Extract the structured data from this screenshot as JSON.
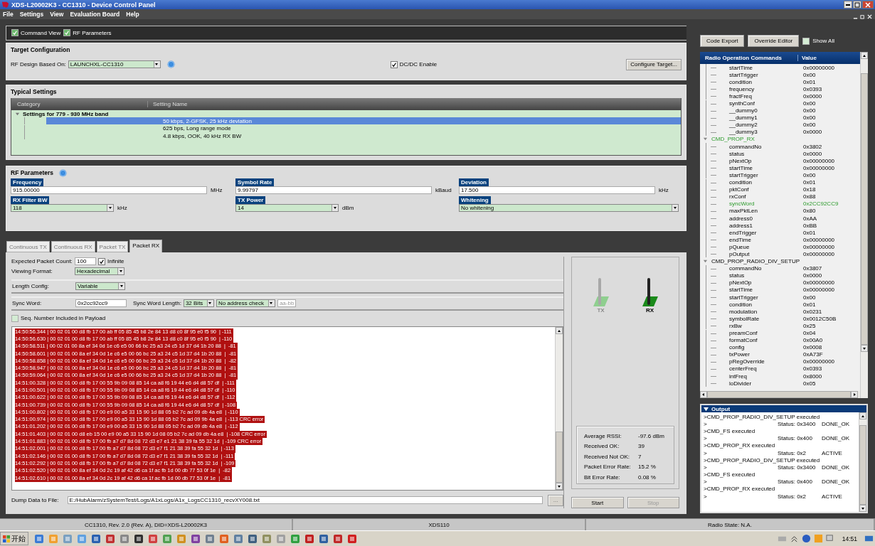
{
  "window": {
    "title": "XDS-L20002K3 - CC1310 - Device Control Panel"
  },
  "menu": [
    "File",
    "Settings",
    "View",
    "Evaluation Board",
    "Help"
  ],
  "view_toggles": [
    {
      "label": "Command View",
      "checked": true
    },
    {
      "label": "RF Parameters",
      "checked": true
    }
  ],
  "target_configuration": {
    "title": "Target Configuration",
    "design_label": "RF Design Based On:",
    "design_value": "LAUNCHXL-CC1310",
    "dcdc": {
      "label": "DC/DC Enable",
      "checked": true
    },
    "configure_button": "Configure Target..."
  },
  "typical_settings": {
    "title": "Typical Settings",
    "columns": [
      "Category",
      "Setting Name"
    ],
    "group": {
      "name": "Settings for 779 - 930 MHz band",
      "expanded": true
    },
    "items": [
      {
        "name": "50 kbps, 2-GFSK, 25 kHz deviation",
        "selected": true
      },
      {
        "name": "625 bps, Long range mode",
        "selected": false
      },
      {
        "name": "4.8 kbps, OOK, 40 kHz RX BW",
        "selected": false
      }
    ]
  },
  "rf_parameters": {
    "title": "RF Parameters",
    "fields": [
      {
        "label": "Frequency",
        "kind": "input",
        "value": "915.00000",
        "unit": "MHz"
      },
      {
        "label": "Symbol Rate",
        "kind": "input",
        "value": "9.99797",
        "unit": "kBaud"
      },
      {
        "label": "Deviation",
        "kind": "input",
        "value": "17.500",
        "unit": "kHz"
      },
      {
        "label": "RX Filter BW",
        "kind": "select",
        "value": "118",
        "unit": "kHz"
      },
      {
        "label": "TX Power",
        "kind": "select",
        "value": "14",
        "unit": "dBm"
      },
      {
        "label": "Whitening",
        "kind": "select",
        "value": "No whitening"
      }
    ]
  },
  "tabs": [
    {
      "label": "Continuous TX",
      "selected": false
    },
    {
      "label": "Continuous RX",
      "selected": false
    },
    {
      "label": "Packet TX",
      "selected": false
    },
    {
      "label": "Packet RX",
      "selected": true
    }
  ],
  "packet_rx": {
    "expected_label": "Expected Packet Count:",
    "expected_value": "100",
    "infinite": {
      "label": "Infinite",
      "checked": true
    },
    "viewing_label": "Viewing Format:",
    "viewing_value": "Hexadecimal",
    "length_label": "Length Config:",
    "length_value": "Variable",
    "sync_label": "Sync Word:",
    "sync_value": "0x2cc92cc9",
    "sync_length_label": "Sync Word Length:",
    "sync_length_value": "32 Bits",
    "address_check": "No address check",
    "address_value": "aa-bb",
    "seq": {
      "label": "Seq. Number Included in Payload",
      "checked": false
    },
    "log": [
      {
        "text": "14:50:56.344 | 00 02 01 00 d8 fb 17 00 ab ff 05 85 45 b8 2e 84 13 d8 c0 8f 95 e0 f5 90  | -111",
        "selected": true
      },
      {
        "text": "14:50:56.630 | 00 02 01 00 d8 fb 17 00 ab ff 05 85 45 b8 2e 84 13 d8 c0 8f 95 e0 f5 90  | -110",
        "selected": true
      },
      {
        "text": "14:50:58.511 | 00 02 01 00 8a ef 34 0d 1e c6 e5 00 66 bc 25 a3 24 c5 1d 37 d4 1b 20 88  |  -81",
        "selected": true
      },
      {
        "text": "14:50:58.601 | 00 02 01 00 8a ef 34 0d 1e c6 e5 00 66 bc 25 a3 24 c5 1d 37 d4 1b 20 88  |  -81",
        "selected": true
      },
      {
        "text": "14:50:58.858 | 00 02 01 00 8a ef 34 0d 1e c6 e5 00 66 bc 25 a3 24 c5 1d 37 d4 1b 20 88  |  -82",
        "selected": true
      },
      {
        "text": "14:50:58.947 | 00 02 01 00 8a ef 34 0d 1e c6 e5 00 66 bc 25 a3 24 c5 1d 37 d4 1b 20 88  |  -81",
        "selected": true
      },
      {
        "text": "14:50:59.064 | 00 02 01 00 8a ef 34 0d 1e c6 e5 00 66 bc 25 a3 24 c5 1d 37 d4 1b 20 88  |  -81",
        "selected": true
      },
      {
        "text": "14:51:00.328 | 00 02 01 00 d8 fb 17 00 55 9b 09 08 85 14 ca a8 f6 19 44 e6 d4 d8 57 df  | -111",
        "selected": true
      },
      {
        "text": "14:51:00.501 | 00 02 01 00 d8 fb 17 00 55 9b 09 08 85 14 ca a8 f6 19 44 e6 d4 d8 57 df  | -110",
        "selected": true
      },
      {
        "text": "14:51:00.622 | 00 02 01 00 d8 fb 17 00 55 9b 09 08 85 14 ca a8 f6 19 44 e6 d4 d8 57 df  | -112",
        "selected": true
      },
      {
        "text": "14:51:00.739 | 00 02 01 00 d8 fb 17 00 55 9b 09 08 85 14 ca a8 f6 19 44 e6 d4 d8 57 df  | -108",
        "selected": true
      },
      {
        "text": "14:51:00.802 | 00 02 01 00 d8 fb 17 00 e9 00 a5 33 15 90 1d 88 05 b2 7c ad 09 db 4a e8  | -110",
        "selected": true
      },
      {
        "text": "14:51:00.974 | 00 02 01 00 d8 fb 17 00 e9 00 a5 33 15 90 1d 88 05 b2 7c ad 09 9b 4a e8  | -113 CRC error",
        "selected": true
      },
      {
        "text": "14:51:01.202 | 00 02 01 00 d8 fb 17 00 e9 00 a5 33 15 90 1d 88 05 b2 7c ad 09 db 4a e8  | -112",
        "selected": true
      },
      {
        "text": "14:51:01.403 | 00 02 01 00 d8 eb 15 00 e9 00 a5 33 15 90 1d 08 05 b2 7c ad 09 db 4a e8  | -108 CRC error",
        "selected": true
      },
      {
        "text": "14:51:01.883 | 00 02 01 00 d8 fb 17 00 fb a7 d7 8d 08 72 d3 e7 e1 21 38 39 fa 55 32 1d  | -109 CRC error",
        "selected": true
      },
      {
        "text": "14:51:02.001 | 00 02 01 00 d8 fb 17 00 fb a7 d7 8d 08 72 d3 e7 f1 21 38 39 fa 55 32 1d  | -113",
        "selected": true
      },
      {
        "text": "14:51:02.146 | 00 02 01 00 d8 fb 17 00 fb a7 d7 8d 08 72 d3 e7 f1 21 38 39 fa 55 32 1d  | -111",
        "selected": true
      },
      {
        "text": "14:51:02.292 | 00 02 01 00 d8 fb 17 00 fb a7 d7 8d 08 72 d3 e7 f1 21 38 39 fa 55 32 1d  | -109",
        "selected": true
      },
      {
        "text": "14:51:02.520 | 00 02 01 00 8a ef 34 0d 2c 19 af 42 d6 ca 1f ac fb 1d 00 db 77 53 0f 1e  |  -82",
        "selected": true
      },
      {
        "text": "14:51:02.610 | 00 02 01 00 8a ef 34 0d 2c 19 af 42 d6 ca 1f ac fb 1d 00 db 77 53 0f 1e  |  -81",
        "selected": true
      }
    ],
    "dump_label": "Dump Data to File:",
    "dump_path": "E:/HubAlarm/zSystemTest/Logs/A1xLogs/A1x_LogsCC1310_recvXY008.txt",
    "browse_button": "...",
    "indicators": [
      {
        "label": "TX",
        "active": false
      },
      {
        "label": "RX",
        "active": true
      }
    ],
    "stats": [
      {
        "label": "Average RSSI:",
        "value": "-97.6 dBm"
      },
      {
        "label": "Received OK:",
        "value": "39"
      },
      {
        "label": "Received Not OK:",
        "value": "7"
      },
      {
        "label": "Packet Error Rate:",
        "value": "15.2 %"
      },
      {
        "label": "Bit Error Rate:",
        "value": "0.08 %"
      }
    ],
    "buttons": [
      {
        "label": "Start",
        "disabled": false
      },
      {
        "label": "Stop",
        "disabled": true
      }
    ]
  },
  "command_panel": {
    "buttons": [
      "Code Export",
      "Override Editor"
    ],
    "show_all": {
      "label": "Show All",
      "checked": false
    },
    "columns": [
      "Radio Operation Commands",
      "Value"
    ],
    "tree": [
      {
        "name": "startTime",
        "value": "0x00000000",
        "modified": false
      },
      {
        "name": "startTrigger",
        "value": "0x00",
        "modified": false
      },
      {
        "name": "condition",
        "value": "0x01",
        "modified": false
      },
      {
        "name": "frequency",
        "value": "0x0393",
        "modified": false
      },
      {
        "name": "fractFreq",
        "value": "0x0000",
        "modified": false
      },
      {
        "name": "synthConf",
        "value": "0x00",
        "modified": false
      },
      {
        "name": "__dummy0",
        "value": "0x00",
        "modified": false
      },
      {
        "name": "__dummy1",
        "value": "0x00",
        "modified": false
      },
      {
        "name": "__dummy2",
        "value": "0x00",
        "modified": false
      },
      {
        "name": "__dummy3",
        "value": "0x0000",
        "modified": false
      },
      {
        "name": "CMD_PROP_RX",
        "modified": true,
        "expanded": true,
        "children": [
          {
            "name": "commandNo",
            "value": "0x3802",
            "modified": false
          },
          {
            "name": "status",
            "value": "0x0000",
            "modified": false
          },
          {
            "name": "pNextOp",
            "value": "0x00000000",
            "modified": false
          },
          {
            "name": "startTime",
            "value": "0x00000000",
            "modified": false
          },
          {
            "name": "startTrigger",
            "value": "0x00",
            "modified": false
          },
          {
            "name": "condition",
            "value": "0x01",
            "modified": false
          },
          {
            "name": "pktConf",
            "value": "0x18",
            "modified": false
          },
          {
            "name": "rxConf",
            "value": "0x88",
            "modified": false
          },
          {
            "name": "syncWord",
            "value": "0x2CC92CC9",
            "modified": true
          },
          {
            "name": "maxPktLen",
            "value": "0x80",
            "modified": false
          },
          {
            "name": "address0",
            "value": "0xAA",
            "modified": false
          },
          {
            "name": "address1",
            "value": "0xBB",
            "modified": false
          },
          {
            "name": "endTrigger",
            "value": "0x01",
            "modified": false
          },
          {
            "name": "endTime",
            "value": "0x00000000",
            "modified": false
          },
          {
            "name": "pQueue",
            "value": "0x00000000",
            "modified": false
          },
          {
            "name": "pOutput",
            "value": "0x00000000",
            "modified": false
          }
        ]
      },
      {
        "name": "CMD_PROP_RADIO_DIV_SETUP",
        "modified": false,
        "expanded": true,
        "children": [
          {
            "name": "commandNo",
            "value": "0x3807",
            "modified": false
          },
          {
            "name": "status",
            "value": "0x0000",
            "modified": false
          },
          {
            "name": "pNextOp",
            "value": "0x00000000",
            "modified": false
          },
          {
            "name": "startTime",
            "value": "0x00000000",
            "modified": false
          },
          {
            "name": "startTrigger",
            "value": "0x00",
            "modified": false
          },
          {
            "name": "condition",
            "value": "0x01",
            "modified": false
          },
          {
            "name": "modulation",
            "value": "0x0231",
            "modified": false
          },
          {
            "name": "symbolRate",
            "value": "0x0012C50B",
            "modified": false
          },
          {
            "name": "rxBw",
            "value": "0x25",
            "modified": false
          },
          {
            "name": "preamConf",
            "value": "0x04",
            "modified": false
          },
          {
            "name": "formatConf",
            "value": "0x00A0",
            "modified": false
          },
          {
            "name": "config",
            "value": "0x0008",
            "modified": false
          },
          {
            "name": "txPower",
            "value": "0xA73F",
            "modified": false
          },
          {
            "name": "pRegOverride",
            "value": "0x00000000",
            "modified": false
          },
          {
            "name": "centerFreq",
            "value": "0x0393",
            "modified": false
          },
          {
            "name": "intFreq",
            "value": "0x8000",
            "modified": false
          },
          {
            "name": "loDivider",
            "value": "0x05",
            "modified": false
          }
        ]
      }
    ]
  },
  "output": {
    "title": "Output",
    "expanded": true,
    "lines": [
      {
        "kind": "command",
        "text": ">CMD_PROP_RADIO_DIV_SETUP executed"
      },
      {
        "kind": "status",
        "marker": ">",
        "status": "Status: 0x3400",
        "result": "DONE_OK"
      },
      {
        "kind": "command",
        "text": ">CMD_FS executed"
      },
      {
        "kind": "status",
        "marker": ">",
        "status": "Status: 0x400",
        "result": "DONE_OK"
      },
      {
        "kind": "command",
        "text": ">CMD_PROP_RX executed"
      },
      {
        "kind": "status",
        "marker": ">",
        "status": "Status: 0x2",
        "result": "ACTIVE"
      },
      {
        "kind": "command",
        "text": ">CMD_PROP_RADIO_DIV_SETUP executed"
      },
      {
        "kind": "status",
        "marker": ">",
        "status": "Status: 0x3400",
        "result": "DONE_OK"
      },
      {
        "kind": "command",
        "text": ">CMD_FS executed"
      },
      {
        "kind": "status",
        "marker": ">",
        "status": "Status: 0x400",
        "result": "DONE_OK"
      },
      {
        "kind": "command",
        "text": ">CMD_PROP_RX executed"
      },
      {
        "kind": "status",
        "marker": ">",
        "status": "Status: 0x2",
        "result": "ACTIVE"
      }
    ]
  },
  "status_bar": [
    "CC1310, Rev. 2.0 (Rev. A), DID=XDS-L20002K3",
    "XDS110",
    "Radio State: N.A."
  ],
  "taskbar": {
    "start": "开始",
    "clock": "14:51"
  }
}
